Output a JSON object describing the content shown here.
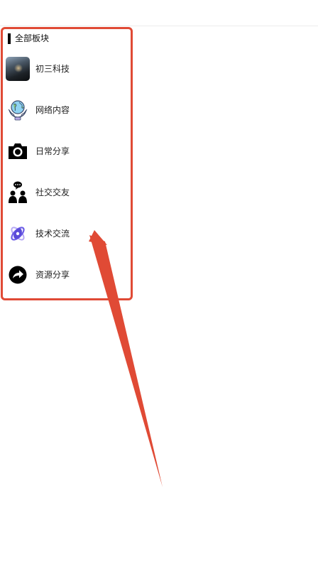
{
  "section": {
    "title": "全部板块"
  },
  "categories": [
    {
      "label": "初三科技",
      "icon": "photo-thumbnail-icon"
    },
    {
      "label": "网络内容",
      "icon": "globe-hands-icon"
    },
    {
      "label": "日常分享",
      "icon": "camera-icon"
    },
    {
      "label": "社交交友",
      "icon": "people-chat-icon"
    },
    {
      "label": "技术交流",
      "icon": "atom-icon"
    },
    {
      "label": "资源分享",
      "icon": "share-arrow-icon"
    }
  ],
  "colors": {
    "annotation": "#e04a35",
    "text": "#222222",
    "atom_accent": "#6b5ce7"
  }
}
